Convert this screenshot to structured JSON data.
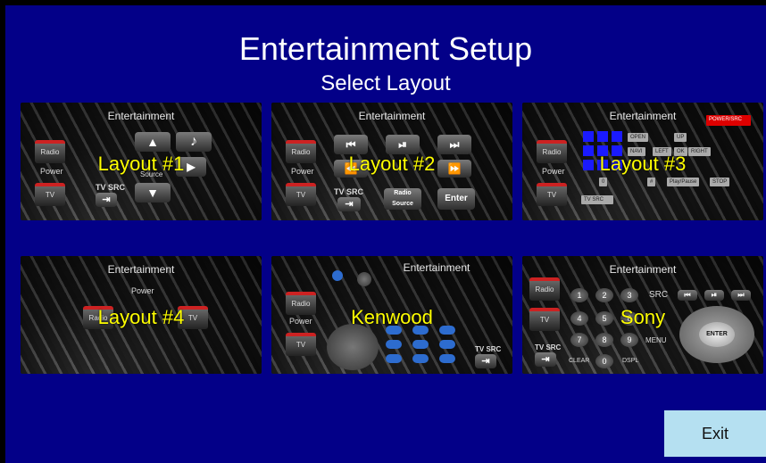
{
  "header": {
    "title": "Entertainment Setup",
    "subtitle": "Select Layout"
  },
  "layouts": [
    {
      "name": "Layout #1",
      "header": "Entertainment",
      "controls": {
        "radio": "Radio",
        "power": "Power",
        "tv": "TV",
        "tv_src": "TV SRC",
        "source": "Source"
      }
    },
    {
      "name": "Layout #2",
      "header": "Entertainment",
      "controls": {
        "radio": "Radio",
        "power": "Power",
        "tv": "TV",
        "tv_src": "TV SRC",
        "radio_source": "Radio\nSource",
        "enter": "Enter"
      }
    },
    {
      "name": "Layout #3",
      "header": "Entertainment",
      "controls": {
        "radio": "Radio",
        "power": "Power",
        "tv": "TV",
        "power_src": "POWER/SRC",
        "open": "OPEN",
        "up": "UP",
        "navi": "NAVI",
        "left": "LEFT",
        "ok": "OK",
        "right": "RIGHT",
        "zero": "0",
        "hash": "#",
        "play_pause": "Play/Pause",
        "stop": "STOP",
        "tv_src": "TV SRC"
      }
    },
    {
      "name": "Layout #4",
      "header": "Entertainment",
      "controls": {
        "power": "Power",
        "radio": "Radio",
        "tv": "TV"
      }
    },
    {
      "name": "Kenwood",
      "header": "Entertainment",
      "controls": {
        "radio": "Radio",
        "power": "Power",
        "tv": "TV",
        "tv_src": "TV SRC"
      }
    },
    {
      "name": "Sony",
      "header": "Entertainment",
      "controls": {
        "radio": "Radio",
        "tv": "TV",
        "tv_src": "TV SRC",
        "src": "SRC",
        "menu": "MENU",
        "clear": "CLEAR",
        "displ": "DSPL",
        "enter": "ENTER",
        "digits": [
          "1",
          "2",
          "3",
          "4",
          "5",
          "6",
          "7",
          "8",
          "9",
          "0"
        ]
      }
    }
  ],
  "footer": {
    "exit": "Exit"
  },
  "colors": {
    "background": "#030088",
    "label": "#ffff00",
    "exit_bg": "#b5e0f1"
  }
}
